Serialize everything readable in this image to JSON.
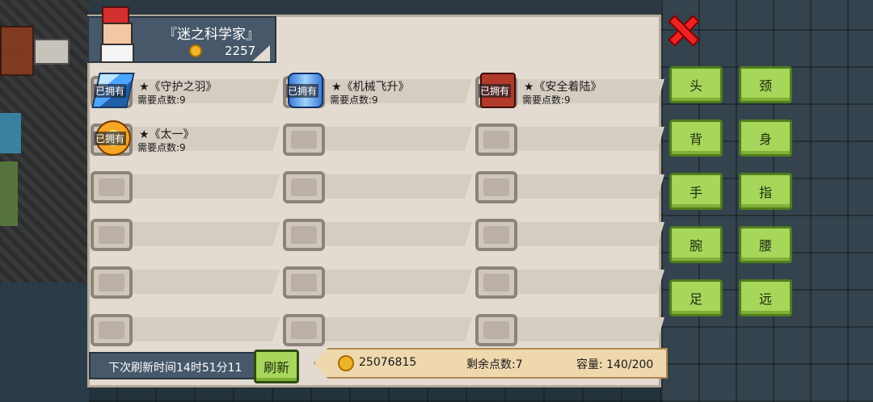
{
  "header": {
    "player_name": "『迷之科学家』",
    "gold": "2257"
  },
  "slots": [
    {
      "title": "★《守护之羽》",
      "cost": "需要点数:9",
      "owned": "已拥有",
      "art": "feather"
    },
    {
      "title": "★《机械飞升》",
      "cost": "需要点数:9",
      "owned": "已拥有",
      "art": "mech"
    },
    {
      "title": "★《安全着陆》",
      "cost": "需要点数:9",
      "owned": "已拥有",
      "art": "safe"
    },
    {
      "title": "★《太一》",
      "cost": "需要点数:9",
      "owned": "已拥有",
      "art": "taiyi"
    }
  ],
  "categories": [
    "头",
    "颈",
    "背",
    "身",
    "手",
    "指",
    "腕",
    "腰",
    "足",
    "远"
  ],
  "bottom": {
    "refresh_timer": "下次刷新时间14时51分11",
    "refresh_button": "刷新",
    "gold": "25076815",
    "remaining_points": "剩余点数:7",
    "capacity": "容量:  140/200"
  },
  "colors": {
    "panel": "#e3dbd1",
    "button_green": "#a6d65a",
    "header_bg": "#46586a",
    "close_red": "#ee2222"
  }
}
